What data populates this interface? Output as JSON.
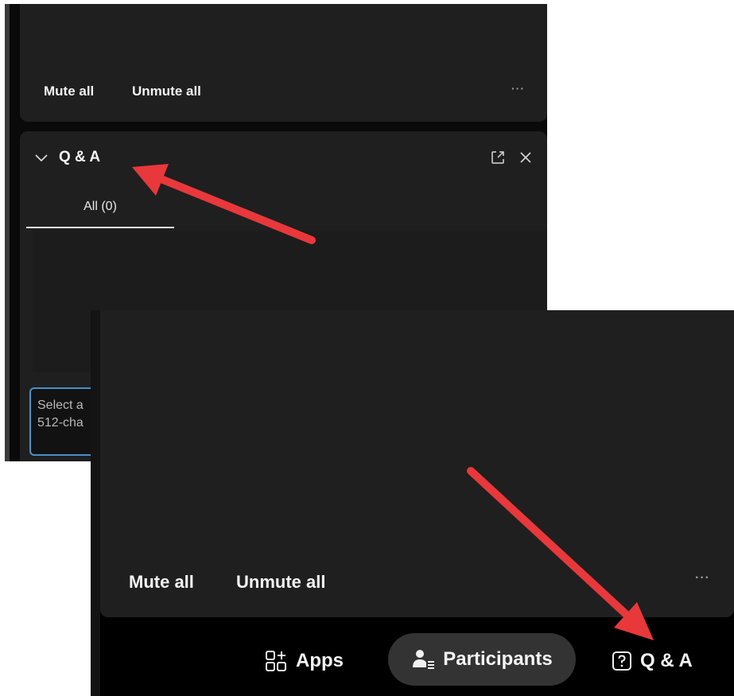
{
  "top_screenshot": {
    "mute_all": "Mute all",
    "unmute_all": "Unmute all",
    "more": "···",
    "qa_panel": {
      "title": "Q & A",
      "tab_all": "All (0)",
      "input_placeholder_line1": "Select a",
      "input_placeholder_line2": "512-cha"
    }
  },
  "bottom_screenshot": {
    "mute_all": "Mute all",
    "unmute_all": "Unmute all",
    "more": "···",
    "toolbar": {
      "apps": "Apps",
      "participants": "Participants",
      "qa": "Q & A"
    }
  },
  "colors": {
    "panel": "#1f1f1f",
    "arrow": "#e8383b",
    "input_focus": "#4a90c8"
  }
}
